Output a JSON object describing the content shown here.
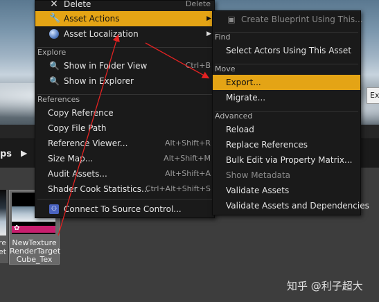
{
  "main_menu": {
    "items": [
      {
        "label": "Delete",
        "shortcut": "Delete",
        "icon": "x-icon"
      },
      {
        "label": "Asset Actions",
        "icon": "wrench-icon",
        "submenu": true,
        "highlighted": true
      },
      {
        "label": "Asset Localization",
        "icon": "globe-icon",
        "submenu": true
      }
    ],
    "section_explore": "Explore",
    "explore_items": [
      {
        "label": "Show in Folder View",
        "shortcut": "Ctrl+B",
        "icon": "search-icon"
      },
      {
        "label": "Show in Explorer",
        "icon": "search-icon"
      }
    ],
    "section_references": "References",
    "reference_items": [
      {
        "label": "Copy Reference",
        "shortcut": ""
      },
      {
        "label": "Copy File Path",
        "shortcut": ""
      },
      {
        "label": "Reference Viewer...",
        "shortcut": "Alt+Shift+R"
      },
      {
        "label": "Size Map...",
        "shortcut": "Alt+Shift+M"
      },
      {
        "label": "Audit Assets...",
        "shortcut": "Alt+Shift+A"
      },
      {
        "label": "Shader Cook Statistics...",
        "shortcut": "Ctrl+Alt+Shift+S"
      }
    ],
    "source_control": {
      "label": "Connect To Source Control...",
      "icon": "source-control-icon"
    }
  },
  "sub_menu": {
    "top_item": {
      "label": "Create Blueprint Using This...",
      "icon": "blueprint-icon",
      "disabled": true
    },
    "section_find": "Find",
    "find_items": [
      "Select Actors Using This Asset"
    ],
    "section_move": "Move",
    "move_items": [
      {
        "label": "Export...",
        "highlighted": true
      },
      {
        "label": "Migrate...",
        "highlighted": false
      }
    ],
    "section_advanced": "Advanced",
    "advanced_items": [
      {
        "label": "Reload",
        "disabled": false
      },
      {
        "label": "Replace References",
        "disabled": false
      },
      {
        "label": "Bulk Edit via Property Matrix...",
        "disabled": false
      },
      {
        "label": "Show Metadata",
        "disabled": true
      },
      {
        "label": "Validate Assets",
        "disabled": false
      },
      {
        "label": "Validate Assets and Dependencies",
        "disabled": false
      }
    ]
  },
  "toolbar": {
    "crumb": "ps",
    "arrow_icon": "play-arrow-icon"
  },
  "assets": {
    "left_partial_label": "re\net",
    "tile_label": "NewTexture\nRenderTarget\nCube_Tex",
    "badge_icon": "flower-icon"
  },
  "export_stub": "Ex",
  "watermark": "知乎 @利子超大",
  "colors": {
    "highlight": "#e4a415",
    "menu_bg": "#1a1a1a",
    "annotation_arrow": "#e32222",
    "tile_pink": "#c81e6e"
  }
}
